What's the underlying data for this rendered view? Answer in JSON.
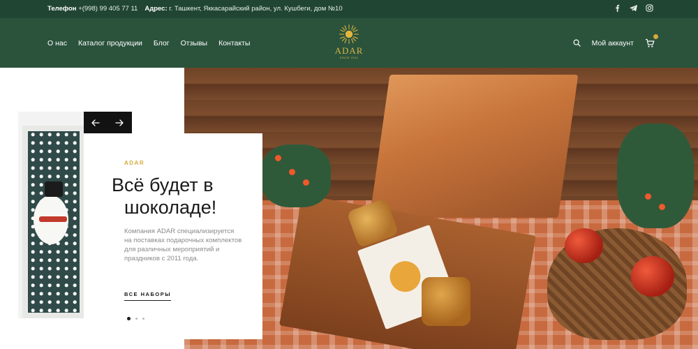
{
  "topbar": {
    "phone_label": "Телефон",
    "phone_value": "+(998) 99 405 77 11",
    "address_label": "Адрес:",
    "address_value": "г. Ташкент, Яккасарайский район, ул. Кушбеги, дом №10",
    "socials": [
      "facebook-icon",
      "telegram-icon",
      "instagram-icon"
    ]
  },
  "header": {
    "nav": [
      "О нас",
      "Каталог продукции",
      "Блог",
      "Отзывы",
      "Контакты"
    ],
    "logo": {
      "brand": "ADAR",
      "since": "SINCE 2011"
    },
    "account_label": "Мой аккаунт"
  },
  "hero": {
    "eyebrow": "ADAR",
    "title_line1": "Всё будет в",
    "title_line2": "шоколаде!",
    "description": "Компания ADAR специализируется на поставках подарочных комплектов для различных мероприятий и праздников с 2011 года.",
    "cta_label": "ВСЕ НАБОРЫ",
    "slides": 3,
    "active_slide": 1
  },
  "colors": {
    "topbar_bg": "#204533",
    "header_bg": "#2b533c",
    "accent_gold": "#d6a93a",
    "text_dark": "#1a1a1a",
    "text_muted": "#8a8a8a"
  }
}
